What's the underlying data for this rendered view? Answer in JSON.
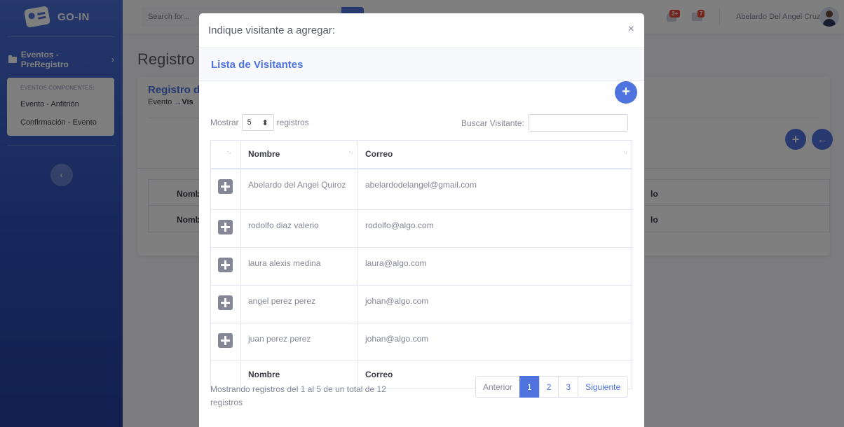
{
  "app": {
    "name": "GO-IN"
  },
  "sidebar": {
    "nav_item": "Eventos - PreRegistro",
    "submenu_header": "EVENTOS COMPONENTES:",
    "submenu_items": [
      "Evento - Anfitrión",
      "Confirmación - Evento"
    ]
  },
  "topbar": {
    "search_placeholder": "Search for...",
    "alerts_badge": "3+",
    "messages_badge": "7",
    "user_name": "Abelardo Del Angel Cruz"
  },
  "page": {
    "title": "Registro",
    "card_title": "Registro d",
    "breadcrumb_start": "Evento",
    "breadcrumb_arrow": "→",
    "breadcrumb_next": "Vis",
    "bg_rows": [
      {
        "c1": "Nomb",
        "c2": "lo"
      },
      {
        "c1": "Nomb",
        "c2": "lo"
      }
    ]
  },
  "modal": {
    "title": "Indique visitante a agregar:",
    "close": "×",
    "card_title": "Lista de Visitantes",
    "add_button": "+",
    "length_label_pre": "Mostrar",
    "length_value": "5",
    "length_label_post": "registros",
    "search_label": "Buscar Visitante:",
    "columns": [
      "",
      "Nombre",
      "Correo"
    ],
    "rows": [
      {
        "nombre": "Abelardo del Angel Quiroz",
        "correo": "abelardodelangel@gmail.com"
      },
      {
        "nombre": "rodolfo diaz valerio",
        "correo": "rodolfo@algo.com"
      },
      {
        "nombre": "laura alexis medina",
        "correo": "laura@algo.com"
      },
      {
        "nombre": "angel perez perez",
        "correo": "johan@algo.com"
      },
      {
        "nombre": "juan perez perez",
        "correo": "johan@algo.com"
      }
    ],
    "footer_columns": [
      "",
      "Nombre",
      "Correo"
    ],
    "info": "Mostrando registros del 1 al 5 de un total de 12 registros",
    "pagination": {
      "previous": "Anterior",
      "pages": [
        "1",
        "2",
        "3"
      ],
      "active_page": "1",
      "next": "Siguiente"
    }
  }
}
